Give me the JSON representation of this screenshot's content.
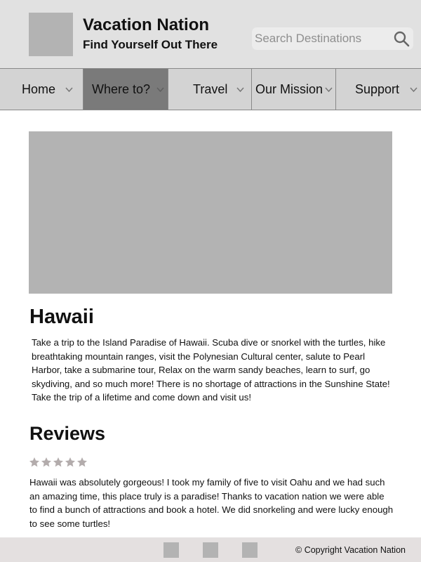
{
  "header": {
    "title": "Vacation Nation",
    "tagline": "Find Yourself Out There",
    "search": {
      "placeholder": "Search Destinations",
      "value": ""
    },
    "icons": {
      "logo": "logo-placeholder",
      "search": "search-icon"
    }
  },
  "nav": {
    "items": [
      {
        "label": "Home",
        "icon": "chevron-down-icon"
      },
      {
        "label": "Where to?",
        "icon": "chevron-down-icon",
        "active": true
      },
      {
        "label": "Travel",
        "icon": "chevron-down-icon"
      },
      {
        "label": "Our Mission",
        "icon": "chevron-down-icon"
      },
      {
        "label": "Support",
        "icon": "chevron-down-icon"
      }
    ]
  },
  "destination": {
    "name": "Hawaii",
    "description": "Take a trip to the Island Paradise of Hawaii. Scuba dive or snorkel with the turtles, hike breathtaking mountain ranges, visit the Polynesian Cultural center, salute to Pearl Harbor, take a submarine tour, Relax on the warm sandy beaches, learn to surf, go skydiving, and so much more! There is no shortage of attractions in the Sunshine State! Take the trip of a lifetime and come down and visit us!"
  },
  "reviews": {
    "heading": "Reviews",
    "items": [
      {
        "rating": 5,
        "max_rating": 5,
        "text": "Hawaii was absolutely gorgeous! I took my family of five to visit Oahu and we had such an amazing time, this place truly is a paradise! Thanks to vacation nation we were able to find a bunch of attractions and book a hotel. We did snorkeling and were lucky enough to see some turtles!"
      }
    ]
  },
  "footer": {
    "copyright": "© Copyright Vacation Nation",
    "social_icons": [
      "social-icon",
      "social-icon",
      "social-icon"
    ]
  },
  "colors": {
    "header_bg": "#e1e1e1",
    "nav_active_bg": "#7a7a7a",
    "placeholder_gray": "#b3b3b3",
    "star_color": "#b3acac",
    "footer_bg": "#e4e0e0"
  }
}
